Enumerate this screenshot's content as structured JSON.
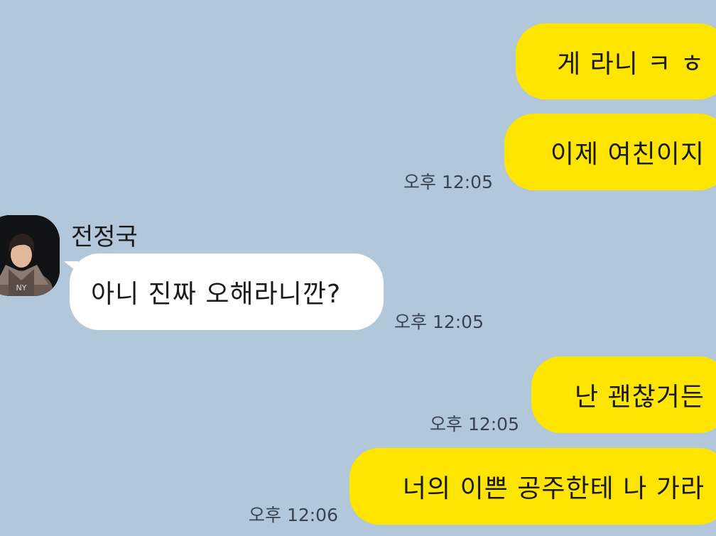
{
  "chat": {
    "sender_name": "전정국",
    "messages": [
      {
        "side": "me",
        "text": "게 라니 ㅋ ㅎ",
        "time": ""
      },
      {
        "side": "me",
        "text": "이제 여친이지",
        "time": "오후 12:05"
      },
      {
        "side": "other",
        "text": "아니 진짜 오해라니깐?",
        "time": "오후 12:05"
      },
      {
        "side": "me",
        "text": "난 괜찮거든",
        "time": "오후 12:05"
      },
      {
        "side": "me",
        "text": "너의 이쁜 공주한테 나 가라",
        "time": "오후 12:06"
      }
    ]
  },
  "colors": {
    "background": "#b2c7da",
    "my_bubble": "#fee500",
    "other_bubble": "#ffffff"
  },
  "icons": {
    "avatar": "profile-photo"
  }
}
